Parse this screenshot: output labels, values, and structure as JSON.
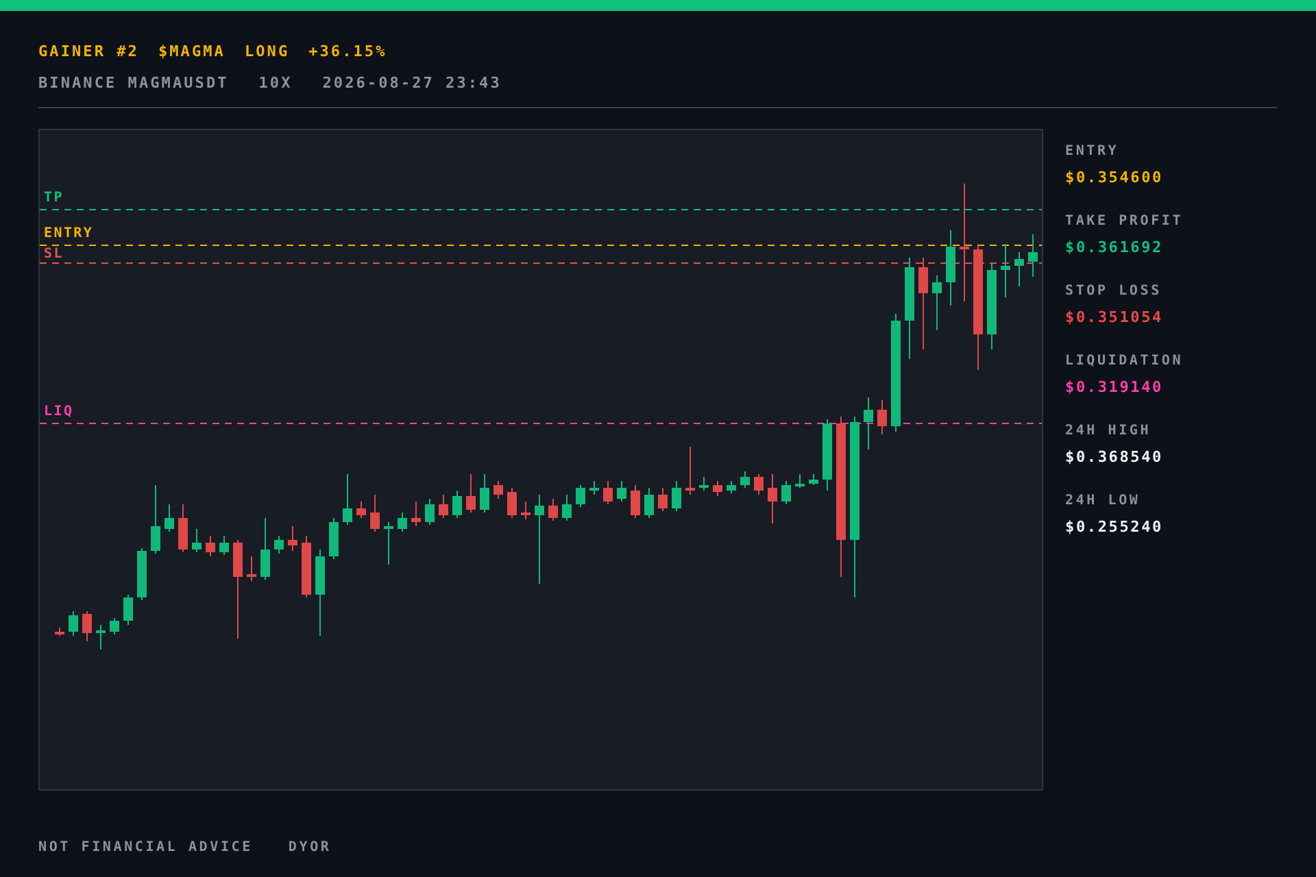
{
  "header": {
    "headline": [
      {
        "text": "GAINER #2"
      },
      {
        "text": "$MAGMA"
      },
      {
        "text": "LONG"
      },
      {
        "text": "+36.15%"
      }
    ],
    "subline": [
      {
        "text": "BINANCE MAGMAUSDT"
      },
      {
        "text": "10X"
      },
      {
        "text": "2026-08-27 23:43"
      }
    ]
  },
  "chart": {
    "levels": [
      {
        "label": "TP",
        "color": "#10c07c"
      },
      {
        "label": "ENTRY",
        "color": "#f5b400"
      },
      {
        "label": "SL",
        "color": "#e5534b"
      },
      {
        "label": "LIQ",
        "color": "#ff3fa8"
      }
    ]
  },
  "stats": [
    {
      "label": "ENTRY",
      "value": "$0.354600",
      "color": "#f5b400"
    },
    {
      "label": "TAKE PROFIT",
      "value": "$0.361692",
      "color": "#10c07c"
    },
    {
      "label": "STOP LOSS",
      "value": "$0.351054",
      "color": "#f04848"
    },
    {
      "label": "LIQUIDATION",
      "value": "$0.319140",
      "color": "#ff3fa8"
    },
    {
      "label": "24H HIGH",
      "value": "$0.368540",
      "color": "#f3f4f6"
    },
    {
      "label": "24H LOW",
      "value": "$0.255240",
      "color": "#f3f4f6"
    }
  ],
  "footer": [
    {
      "text": "NOT FINANCIAL ADVICE"
    },
    {
      "text": "DYOR"
    }
  ]
}
